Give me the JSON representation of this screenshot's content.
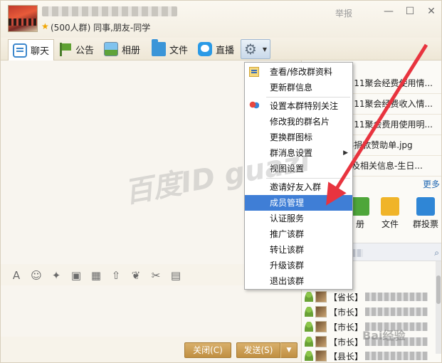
{
  "header": {
    "group_meta": "(500人群) 同事,朋友-同学",
    "report_label": "举报",
    "minimize": "—",
    "maximize": "☐",
    "close": "✕"
  },
  "toolbar": {
    "chat": "聊天",
    "notice": "公告",
    "album": "相册",
    "files": "文件",
    "live": "直播",
    "gear": "⚙",
    "gear_caret": "▼"
  },
  "menu": {
    "items": [
      "查看/修改群资料",
      "更新群信息",
      "设置本群特别关注",
      "修改我的群名片",
      "更换群图标",
      "群消息设置",
      "视图设置",
      "邀请好友入群",
      "成员管理",
      "认证服务",
      "推广该群",
      "转让该群",
      "升级该群",
      "退出该群"
    ],
    "submenu_arrow": "▶",
    "highlighted": "成员管理"
  },
  "files": {
    "rows": [
      "0211聚会经费使用情...",
      "0211聚会经费收入情...",
      "0211聚会费用使用明...",
      "18捐款赞助单.jpg",
      "录及相关信息-生日..."
    ],
    "more": "更多"
  },
  "apps": {
    "album": "册",
    "files": "文件",
    "vote": "群投票"
  },
  "members": {
    "titles": [
      "【省长】",
      "【市长】",
      "【市长】",
      "【市长】",
      "【县长】"
    ]
  },
  "input_toolbar": {
    "icons": [
      "A",
      "☺",
      "✦",
      "▣",
      "▦",
      "⇧",
      "❦",
      "✂",
      "▤"
    ]
  },
  "actions": {
    "close": "关闭(C)",
    "send": "发送(S)",
    "send_caret": "▼"
  },
  "watermark": {
    "text": "百度ID guazi",
    "jingyan": "Bai经验"
  },
  "colors": {
    "highlight": "#3f7ed6",
    "arrow": "#e8343f",
    "button": "#c99a50"
  }
}
